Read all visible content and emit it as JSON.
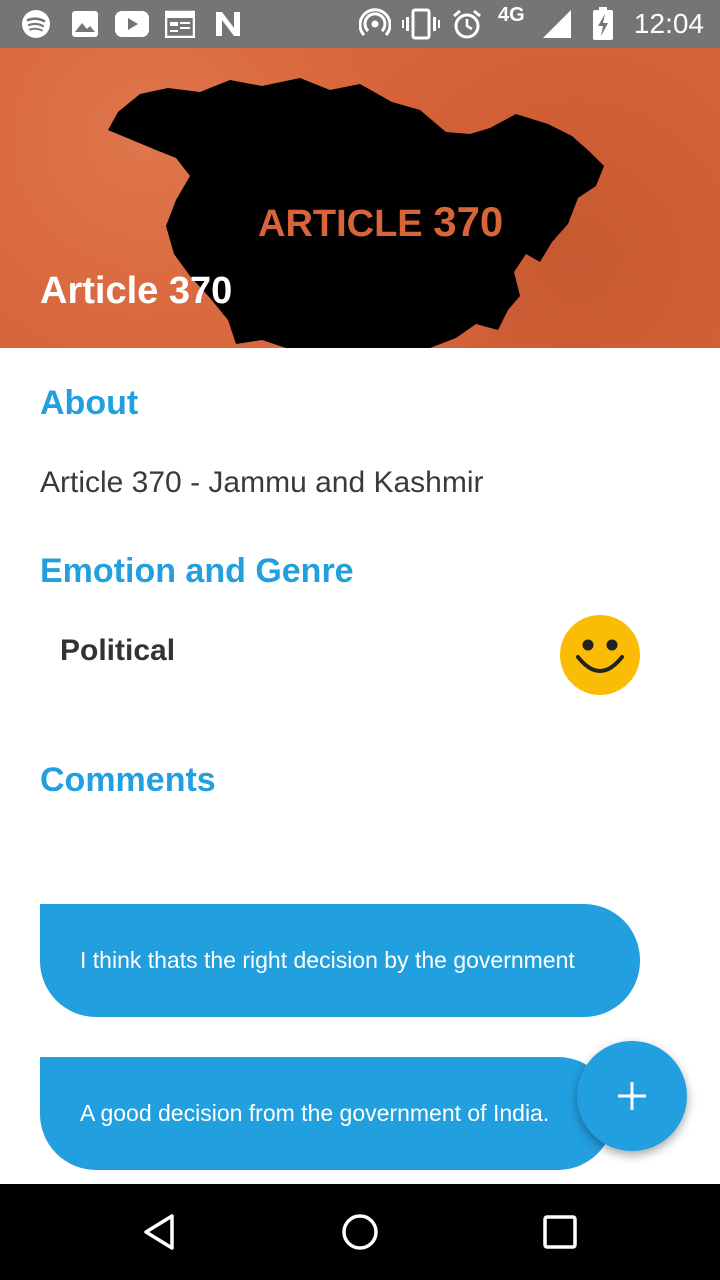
{
  "status_bar": {
    "time": "12:04",
    "network": "4G",
    "icons": [
      "spotify-icon",
      "image-icon",
      "youtube-icon",
      "calendar-icon",
      "n-icon",
      "hotspot-icon",
      "vibrate-icon",
      "alarm-icon",
      "signal-icon",
      "battery-icon"
    ]
  },
  "header": {
    "banner_text_word": "ARTICLE",
    "banner_text_num": "370",
    "title": "Article 370",
    "colors": {
      "background": "#d8643a",
      "map": "#000000"
    }
  },
  "about": {
    "heading": "About",
    "text": "Article 370 - Jammu and Kashmir"
  },
  "emotion_genre": {
    "heading": "Emotion and Genre",
    "genre": "Political",
    "emotion_icon": "smiley-icon"
  },
  "comments": {
    "heading": "Comments",
    "items": [
      {
        "text": "I think thats the right decision by the government"
      },
      {
        "text": "A good decision from the government of India."
      }
    ]
  },
  "fab": {
    "icon": "plus-icon"
  },
  "nav_bar": {
    "icons": [
      "back-icon",
      "home-icon",
      "recents-icon"
    ]
  },
  "accent_color": "#229fdf"
}
